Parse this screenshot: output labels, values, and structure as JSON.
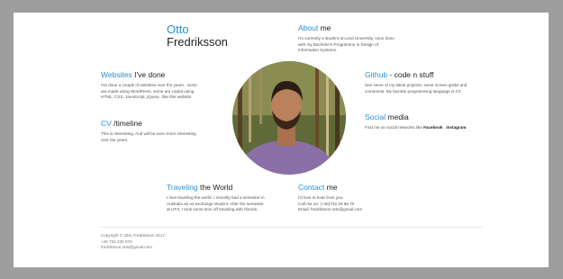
{
  "name": {
    "first": "Otto",
    "last": "Fredriksson"
  },
  "about": {
    "accent": "About",
    "rest": " me",
    "lines": [
      "I'm currently a student at Lund University, soon done",
      "with my Bachelor's Programme in Design of",
      "Information Systems."
    ]
  },
  "websites": {
    "accent": "Websites",
    "rest": " I've done",
    "lines": [
      "I've done a couple of websites over the years.. some",
      "are made using WordPress, some are coded using",
      "HTML, CSS, JavaScript, jQuery.. like this website."
    ]
  },
  "github": {
    "accent": "Github",
    "rest": " - code n stuff",
    "lines": [
      "See some of my latest projects, some screen grabs and",
      "comments. My favorite programming language is C#."
    ]
  },
  "cv": {
    "accent": "CV",
    "rest": " /timeline",
    "lines": [
      "This is interesting. And will be even more interesting",
      "over the years."
    ]
  },
  "social": {
    "accent": "Social",
    "rest": " media",
    "prefix": "Find me on social networks like ",
    "facebook": "Facebook",
    "sep": " , ",
    "instagram": "Instagram",
    "suffix": "."
  },
  "traveling": {
    "accent": "Traveling",
    "rest": " the World",
    "lines": [
      "I love traveling the world. I recently had a semester in",
      "Australia as an exchange student. After the semester",
      "at UTS, I took some time off traveling with friends."
    ]
  },
  "contact": {
    "accent": "Contact",
    "rest": " me",
    "lines": [
      "I'd love to hear from you.",
      "Call me on: (+46)732 20 68 70",
      "Email: fredriksson.otto@gmail.com"
    ]
  },
  "footer": {
    "lines": [
      "Copyright © Otto Fredriksson 2017.",
      "+46 732 206 870",
      "fredriksson.otto@gmail.com"
    ]
  },
  "colors": {
    "accent": "#2b8fcf",
    "frame": "#9e9e9e"
  }
}
